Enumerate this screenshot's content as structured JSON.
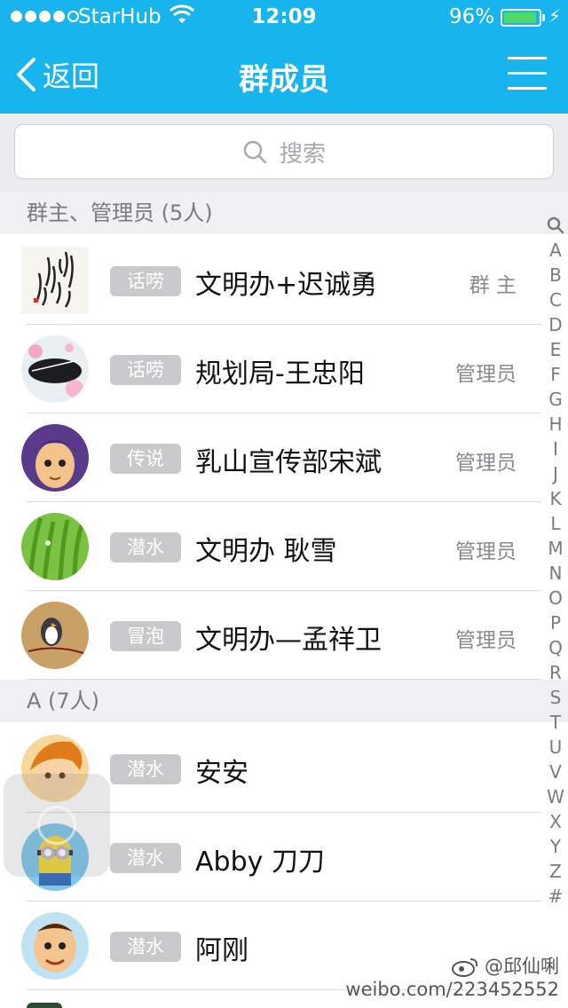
{
  "status_bar": {
    "carrier": "StarHub",
    "time": "12:09",
    "battery_percent": "96%",
    "battery_level": 0.96,
    "signal_filled": 4,
    "signal_total": 5
  },
  "nav": {
    "back_label": "返回",
    "title": "群成员"
  },
  "search": {
    "placeholder": "搜索"
  },
  "sections": [
    {
      "header": "群主、管理员 (5人)",
      "members": [
        {
          "badge": "话唠",
          "name": "文明办+迟诚勇",
          "role": "群 主",
          "avatar": "calligraphy"
        },
        {
          "badge": "话唠",
          "name": "规划局-王忠阳",
          "role": "管理员",
          "avatar": "fan-flowers"
        },
        {
          "badge": "传说",
          "name": "乳山宣传部宋斌",
          "role": "管理员",
          "avatar": "cartoon-boy-purple"
        },
        {
          "badge": "潜水",
          "name": "文明办 耿雪",
          "role": "管理员",
          "avatar": "green-grass"
        },
        {
          "badge": "冒泡",
          "name": "文明办—孟祥卫",
          "role": "管理员",
          "avatar": "penguin-figure"
        }
      ]
    },
    {
      "header": "A (7人)",
      "members": [
        {
          "badge": "潜水",
          "name": "安安",
          "role": "",
          "avatar": "cartoon-boy-orange"
        },
        {
          "badge": "潜水",
          "name": "Abby 刀刀",
          "role": "",
          "avatar": "minion"
        },
        {
          "badge": "潜水",
          "name": "阿刚",
          "role": "",
          "avatar": "cartoon-bald-boy"
        }
      ]
    }
  ],
  "index_letters": [
    "A",
    "B",
    "C",
    "D",
    "E",
    "F",
    "G",
    "H",
    "I",
    "J",
    "K",
    "L",
    "M",
    "N",
    "O",
    "P",
    "Q",
    "R",
    "S",
    "T",
    "U",
    "V",
    "W",
    "X",
    "Y",
    "Z",
    "#"
  ],
  "watermark": {
    "handle": "@邱仙唎",
    "url": "weibo.com/223452552"
  },
  "colors": {
    "nav_blue": "#18b4ed",
    "badge_gray": "#c9c9cc",
    "battery_green": "#4cd964"
  }
}
